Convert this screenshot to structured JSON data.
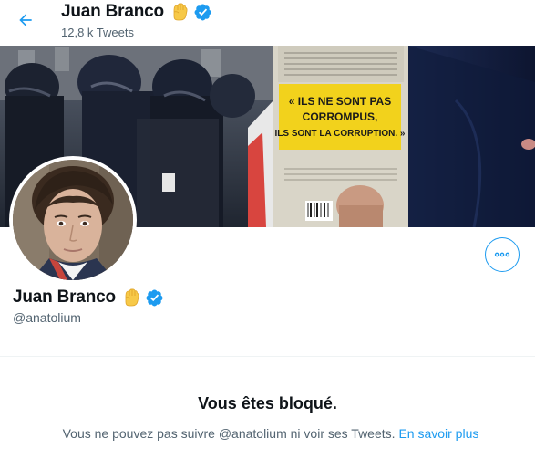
{
  "header": {
    "back_icon": "arrow-left-icon",
    "name": "Juan Branco",
    "tweet_count": "12,8 k Tweets",
    "emoji_icon": "raised-fist-icon",
    "verified_icon": "verified-badge-icon"
  },
  "banner": {
    "book_text_line1": "« ILS NE SONT PAS",
    "book_text_line2": "CORROMPUS,",
    "book_text_line3": "ILS SONT LA CORRUPTION. »"
  },
  "profile": {
    "name": "Juan Branco",
    "handle": "@anatolium",
    "more_icon": "more-options-icon"
  },
  "blocked": {
    "title": "Vous êtes bloqué.",
    "message": "Vous ne pouvez pas suivre @anatolium ni voir ses Tweets.",
    "link": "En savoir plus"
  },
  "colors": {
    "accent": "#1d9bf0",
    "text_primary": "#0f1419",
    "text_secondary": "#536471",
    "fist_yellow": "#f7c948",
    "book_yellow": "#f2d21c"
  }
}
